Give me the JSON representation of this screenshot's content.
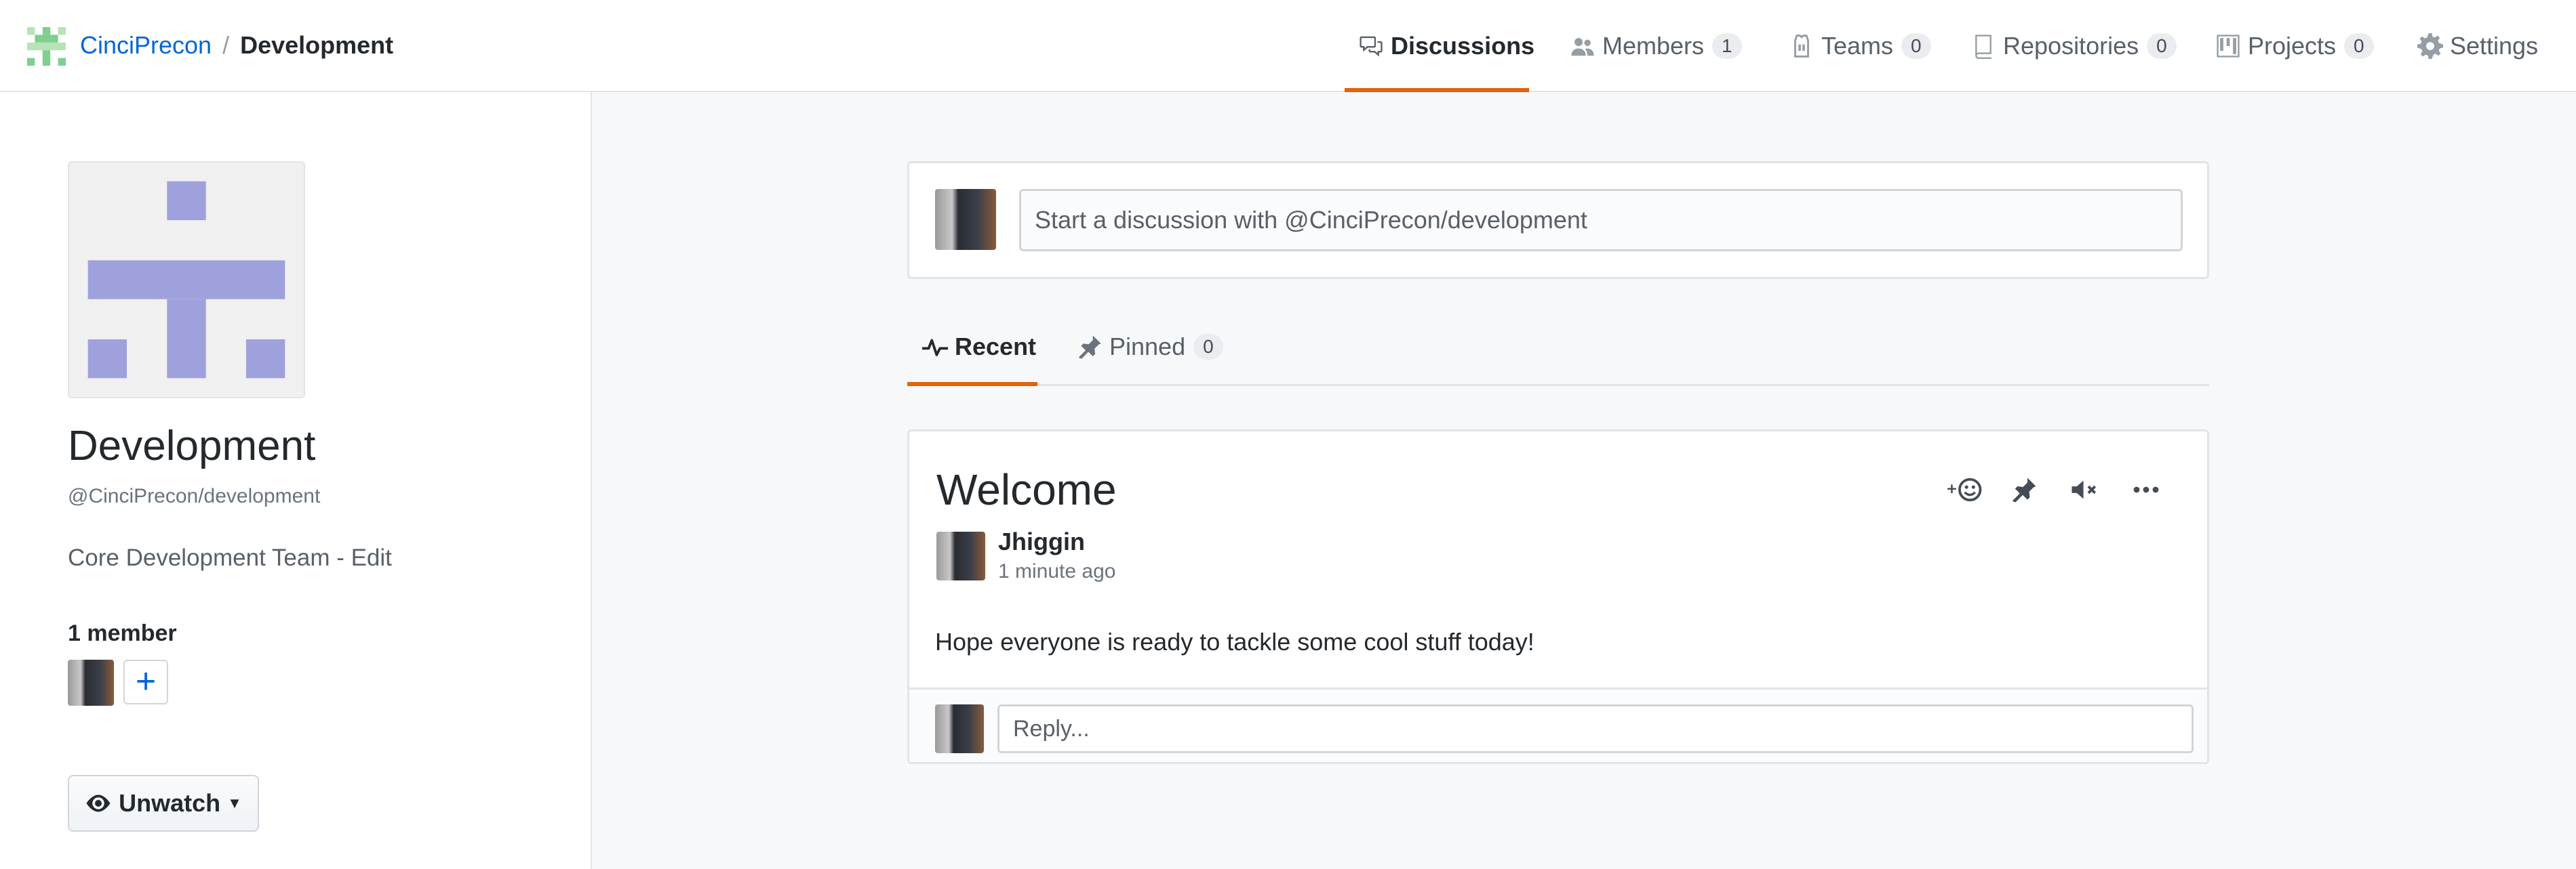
{
  "header": {
    "org": "CinciPrecon",
    "separator": "/",
    "team": "Development",
    "nav": [
      {
        "label": "Discussions",
        "icon": "comment-discussion-icon",
        "count": null,
        "selected": true
      },
      {
        "label": "Members",
        "icon": "people-icon",
        "count": "1",
        "selected": false
      },
      {
        "label": "Teams",
        "icon": "jersey-icon",
        "count": "0",
        "selected": false
      },
      {
        "label": "Repositories",
        "icon": "repo-icon",
        "count": "0",
        "selected": false
      },
      {
        "label": "Projects",
        "icon": "project-icon",
        "count": "0",
        "selected": false
      },
      {
        "label": "Settings",
        "icon": "gear-icon",
        "count": null,
        "selected": false
      }
    ]
  },
  "sidebar": {
    "team_name": "Development",
    "team_handle": "@CinciPrecon/development",
    "description": "Core Development Team - Edit",
    "member_count": "1 member",
    "add_member": "+",
    "watch_button": "Unwatch"
  },
  "composer": {
    "placeholder": "Start a discussion with @CinciPrecon/development"
  },
  "tabs": [
    {
      "label": "Recent",
      "icon": "pulse-icon",
      "count": null,
      "selected": true
    },
    {
      "label": "Pinned",
      "icon": "pin-icon",
      "count": "0",
      "selected": false
    }
  ],
  "post": {
    "title": "Welcome",
    "author": "Jhiggin",
    "time": "1 minute ago",
    "body": "Hope everyone is ready to tackle some cool stuff today!",
    "reply_placeholder": "Reply...",
    "actions": [
      "add-reaction-icon",
      "pin-icon",
      "mute-icon",
      "ellipsis-icon"
    ]
  },
  "colors": {
    "link": "#0366d6",
    "accent_underline": "#e36209",
    "identicon": "#9fa1dc",
    "main_bg": "#f6f8fa"
  }
}
